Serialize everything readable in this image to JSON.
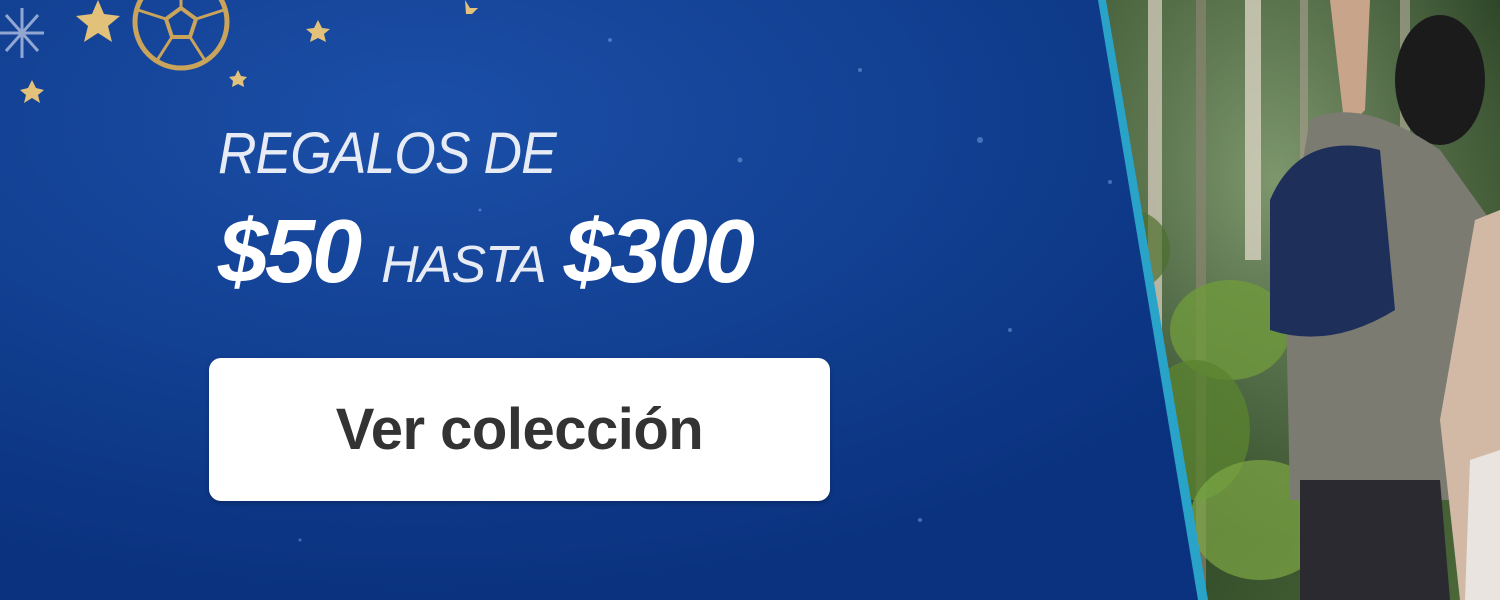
{
  "banner": {
    "line1": "REGALOS DE",
    "price_from": "$50",
    "connector": "HASTA",
    "price_to": "$300",
    "cta_label": "Ver colección"
  },
  "colors": {
    "panel_blue": "#0c3a8c",
    "panel_edge": "#1f8fb8",
    "button_bg": "#ffffff",
    "button_text": "#333333",
    "ornament_gold": "#c9a45a"
  },
  "icons": [
    "snowflake-icon",
    "soccer-ball-ornament-icon",
    "star-icon"
  ]
}
